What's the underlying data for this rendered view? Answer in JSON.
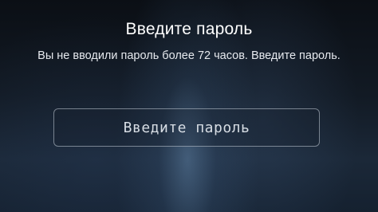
{
  "dialog": {
    "title": "Введите пароль",
    "message": "Вы не вводили пароль более 72 часов. Введите пароль.",
    "password_field": {
      "placeholder": "Введите пароль",
      "value": ""
    }
  }
}
